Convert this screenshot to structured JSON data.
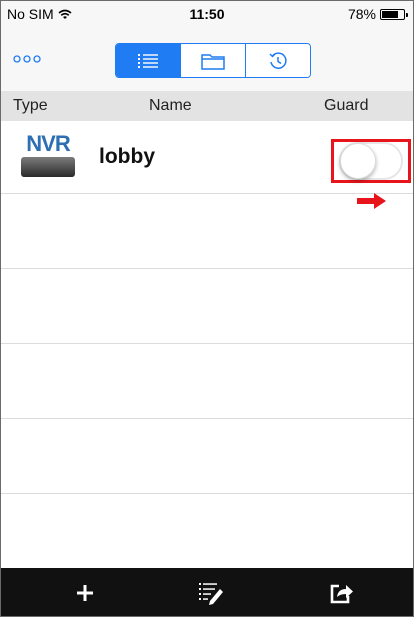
{
  "status_bar": {
    "carrier": "No SIM",
    "time": "11:50",
    "battery": "78%",
    "battery_level": 0.78
  },
  "nav": {
    "more_icon": "more-dots-icon",
    "segments": [
      {
        "icon": "list-icon",
        "active": true
      },
      {
        "icon": "folder-icon",
        "active": false
      },
      {
        "icon": "history-clock-icon",
        "active": false
      }
    ]
  },
  "columns": {
    "type": "Type",
    "name": "Name",
    "guard": "Guard"
  },
  "devices": [
    {
      "type_label": "NVR",
      "name": "lobby",
      "guard": false
    }
  ],
  "toolbar": {
    "add_icon": "plus-icon",
    "edit_icon": "edit-list-icon",
    "share_icon": "share-icon"
  },
  "colors": {
    "accent": "#1f7cf2",
    "annotation": "#e8141c",
    "toolbar": "#111111"
  }
}
